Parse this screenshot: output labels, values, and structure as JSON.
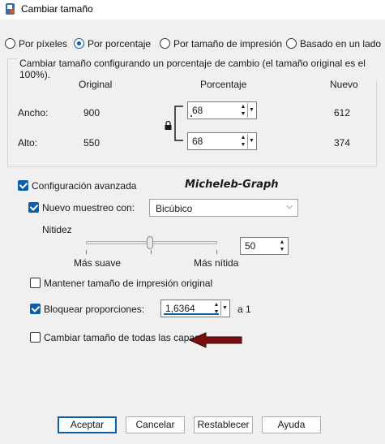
{
  "window": {
    "title": "Cambiar tamaño",
    "icon": "paint-shop-icon"
  },
  "mode": {
    "options": [
      "Por píxeles",
      "Por porcentaje",
      "Por tamaño de impresión",
      "Basado en un lado"
    ],
    "selected": "Por porcentaje"
  },
  "group": {
    "caption": "Cambiar tamaño configurando un porcentaje de cambio (el tamaño original es el 100%).",
    "headers": {
      "original": "Original",
      "percent": "Porcentaje",
      "new": "Nuevo"
    },
    "width": {
      "label": "Ancho:",
      "original": "900",
      "percent": "68",
      "new": "612"
    },
    "height": {
      "label": "Alto:",
      "original": "550",
      "percent": "68",
      "new": "374"
    },
    "link_icon": "padlock-icon"
  },
  "advanced": {
    "label": "Configuración avanzada",
    "checked": true,
    "resample": {
      "label": "Nuevo muestreo con:",
      "checked": true,
      "value": "Bicúbico"
    },
    "sharpness": {
      "label": "Nitidez",
      "value": "50",
      "min_label": "Más suave",
      "max_label": "Más nítida",
      "level": 0.5
    },
    "keep_print_size": {
      "label": "Mantener tamaño de impresión original",
      "checked": false
    },
    "lock_ratio": {
      "label": "Bloquear proporciones:",
      "checked": true,
      "value": "1,6364",
      "suffix": "a 1"
    },
    "all_layers": {
      "label": "Cambiar tamaño de todas las capas",
      "checked": false
    }
  },
  "watermark": "Micheleb-Graph",
  "arrow_color": "#7a0e0e",
  "accent": "#0a5fa8",
  "buttons": {
    "ok": "Aceptar",
    "cancel": "Cancelar",
    "reset": "Restablecer",
    "help": "Ayuda"
  }
}
